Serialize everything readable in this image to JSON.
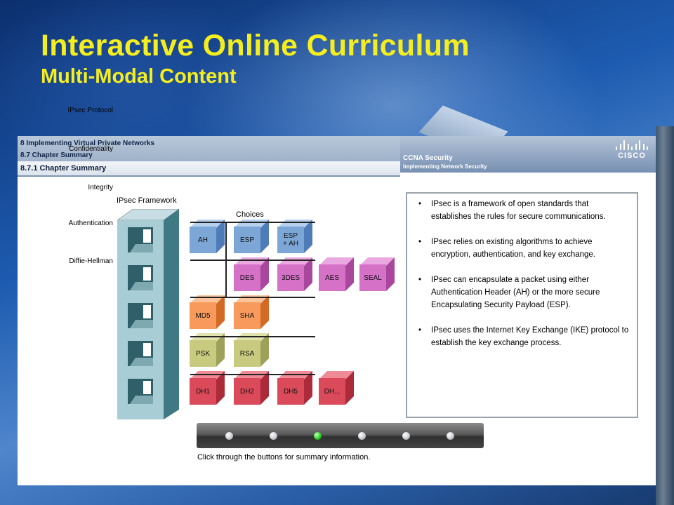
{
  "slide": {
    "title": "Interactive Online Curriculum",
    "subtitle": "Multi-Modal Content"
  },
  "header": {
    "chapter": "8 Implementing Virtual Private Networks",
    "section": "8.7 Chapter Summary",
    "subsection": "8.7.1 Chapter Summary",
    "course": "CCNA Security",
    "course_sub": "Implementing Network Security",
    "logo": "cisco"
  },
  "framework": {
    "title": "IPsec Framework",
    "choices_title": "Choices",
    "rows": [
      {
        "label": "IPsec Protocol",
        "choices": [
          "AH",
          "ESP",
          "ESP\n+ AH"
        ]
      },
      {
        "label": "Confidentiality",
        "choices": [
          "DES",
          "3DES",
          "AES",
          "SEAL"
        ]
      },
      {
        "label": "Integrity",
        "choices": [
          "MD5",
          "SHA"
        ]
      },
      {
        "label": "Authentication",
        "choices": [
          "PSK",
          "RSA"
        ]
      },
      {
        "label": "Diffie-Hellman",
        "choices": [
          "DH1",
          "DH2",
          "DH5",
          "DH..."
        ]
      }
    ]
  },
  "summary": {
    "bullets": [
      "IPsec is a framework of open standards that establishes the rules for secure communications.",
      "IPsec relies on existing algorithms to achieve encryption, authentication, and key exchange.",
      "IPsec can encapsulate a packet using either Authentication Header (AH) or the more secure Encapsulating Security Payload (ESP).",
      "IPsec uses the Internet Key Exchange (IKE) protocol to establish the key exchange process."
    ]
  },
  "navigation": {
    "button_count": 6,
    "active_index": 2,
    "hint": "Click through the buttons for summary information."
  },
  "colors": {
    "title_yellow": "#f5ee1e",
    "active_dot": "#2fd22a",
    "protocol": "#7ba6d6",
    "confidentiality": "#d671c8",
    "integrity": "#f79a5b",
    "authentication": "#c8cb7f",
    "diffie_hellman": "#da4a5a"
  }
}
